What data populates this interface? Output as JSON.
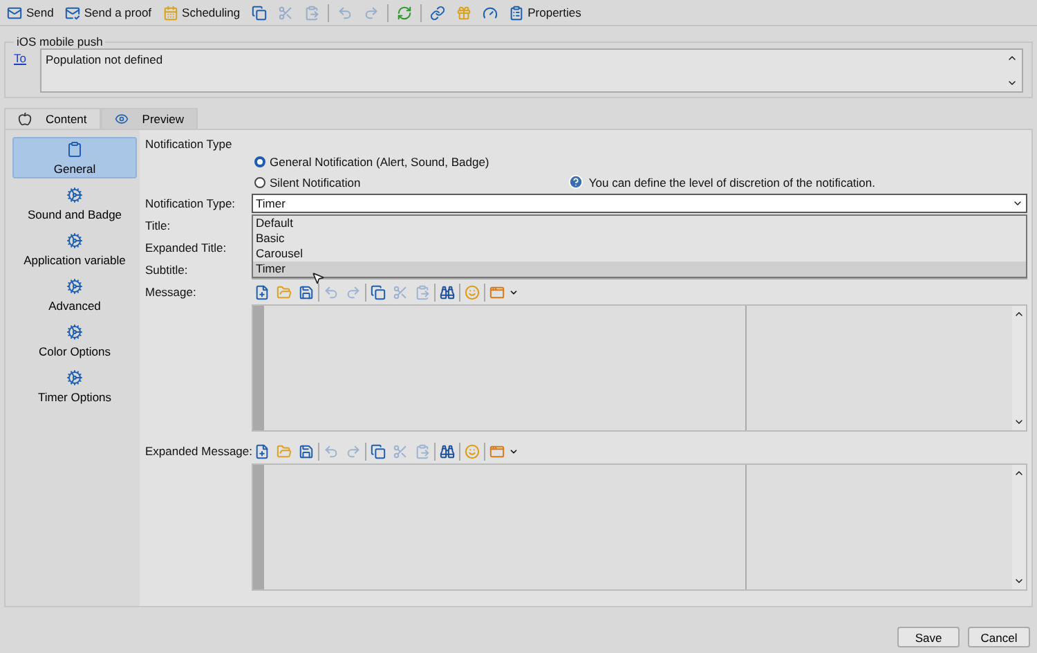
{
  "toolbar": [
    {
      "kind": "send",
      "label": "Send",
      "disabled": false
    },
    {
      "kind": "proof",
      "label": "Send a proof",
      "disabled": false
    },
    {
      "kind": "schedule",
      "label": "Scheduling",
      "disabled": false
    },
    {
      "kind": "copy",
      "disabled": false
    },
    {
      "kind": "cut",
      "disabled": true
    },
    {
      "kind": "paste",
      "disabled": true
    },
    {
      "kind": "separator"
    },
    {
      "kind": "undo",
      "disabled": true
    },
    {
      "kind": "redo",
      "disabled": true
    },
    {
      "kind": "separator"
    },
    {
      "kind": "refresh",
      "disabled": false
    },
    {
      "kind": "separator"
    },
    {
      "kind": "link",
      "disabled": false
    },
    {
      "kind": "gift",
      "disabled": false
    },
    {
      "kind": "gauge",
      "disabled": false
    },
    {
      "kind": "properties",
      "label": "Properties",
      "disabled": false
    }
  ],
  "group": {
    "title": "iOS mobile push",
    "to_link": "To",
    "to_value": "Population not defined"
  },
  "tabs": [
    {
      "kind": "apple",
      "label": "Content",
      "selected": true
    },
    {
      "kind": "eye",
      "label": "Preview",
      "selected": false
    }
  ],
  "sidebar": {
    "items": [
      {
        "kind": "clipboard",
        "label": "General",
        "selected": true
      },
      {
        "kind": "cogs",
        "label": "Sound and Badge",
        "selected": false
      },
      {
        "kind": "cogs",
        "label": "Application variable",
        "selected": false
      },
      {
        "kind": "cogs",
        "label": "Advanced",
        "selected": false
      },
      {
        "kind": "cogs",
        "label": "Color Options",
        "selected": false
      },
      {
        "kind": "cogs",
        "label": "Timer Options",
        "selected": false
      }
    ]
  },
  "form": {
    "heading": "Notification Type",
    "radios": [
      {
        "label": "General Notification (Alert, Sound, Badge)",
        "selected": true
      },
      {
        "label": "Silent Notification",
        "selected": false
      }
    ],
    "info": "You can define the level of discretion of the notification.",
    "fields": [
      {
        "kind": "select",
        "label": "Notification Type:",
        "value": "Timer",
        "expanded": true,
        "options": [
          {
            "label": "Default",
            "selected": false
          },
          {
            "label": "Basic",
            "selected": false
          },
          {
            "label": "Carousel",
            "selected": false
          },
          {
            "label": "Timer",
            "selected": true
          }
        ]
      },
      {
        "kind": "text",
        "label": "Title:"
      },
      {
        "kind": "text",
        "label": "Expanded Title:"
      },
      {
        "kind": "text",
        "label": "Subtitle:"
      }
    ],
    "editors": [
      {
        "label": "Message:",
        "tools": [
          {
            "kind": "new",
            "disabled": false
          },
          {
            "kind": "open",
            "disabled": false
          },
          {
            "kind": "save",
            "disabled": false
          },
          {
            "kind": "separator"
          },
          {
            "kind": "undo",
            "disabled": true
          },
          {
            "kind": "redo",
            "disabled": true
          },
          {
            "kind": "separator"
          },
          {
            "kind": "copy",
            "disabled": false
          },
          {
            "kind": "cut",
            "disabled": true
          },
          {
            "kind": "paste",
            "disabled": true
          },
          {
            "kind": "separator"
          },
          {
            "kind": "find",
            "disabled": false
          },
          {
            "kind": "separator"
          },
          {
            "kind": "emoji",
            "disabled": false
          },
          {
            "kind": "separator"
          },
          {
            "kind": "insert",
            "disabled": false
          }
        ]
      },
      {
        "label": "Expanded Message:",
        "tools": [
          {
            "kind": "new",
            "disabled": false
          },
          {
            "kind": "open",
            "disabled": false
          },
          {
            "kind": "save",
            "disabled": false
          },
          {
            "kind": "separator"
          },
          {
            "kind": "undo",
            "disabled": true
          },
          {
            "kind": "redo",
            "disabled": true
          },
          {
            "kind": "separator"
          },
          {
            "kind": "copy",
            "disabled": false
          },
          {
            "kind": "cut",
            "disabled": true
          },
          {
            "kind": "paste",
            "disabled": true
          },
          {
            "kind": "separator"
          },
          {
            "kind": "find",
            "disabled": false
          },
          {
            "kind": "separator"
          },
          {
            "kind": "emoji",
            "disabled": false
          },
          {
            "kind": "separator"
          },
          {
            "kind": "insert",
            "disabled": false
          }
        ]
      }
    ]
  },
  "buttons": [
    "Save",
    "Cancel"
  ]
}
